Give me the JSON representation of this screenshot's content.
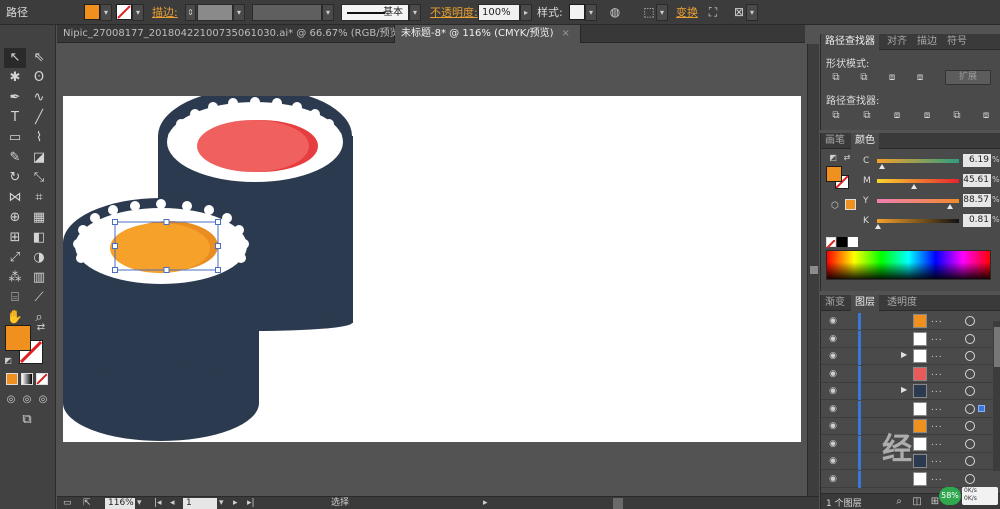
{
  "controlbar": {
    "object_type": "路径",
    "fill_color": "#f0901e",
    "stroke_label": "描边:",
    "stroke_style": "基本",
    "opacity_label": "不透明度:",
    "opacity_value": "100%",
    "style_label": "样式:",
    "transform_label": "变换"
  },
  "tabs": [
    {
      "label": "Nipic_27008177_20180422100735061030.ai* @ 66.67% (RGB/预览)",
      "close": "×"
    },
    {
      "label": "未标题-8* @ 116% (CMYK/预览)",
      "close": "×"
    }
  ],
  "pathfinder_panel": {
    "tabs": [
      "路径查找器",
      "对齐",
      "描边",
      "符号"
    ],
    "shape_modes_label": "形状模式:",
    "expand_label": "扩展",
    "pathfinders_label": "路径查找器:"
  },
  "color_panel": {
    "tabs": [
      "画笔",
      "颜色"
    ],
    "fill_color": "#f0901e",
    "channels": [
      {
        "name": "C",
        "value": "6.19",
        "fraction": 0.0619
      },
      {
        "name": "M",
        "value": "45.61",
        "fraction": 0.4561
      },
      {
        "name": "Y",
        "value": "88.57",
        "fraction": 0.8857
      },
      {
        "name": "K",
        "value": "0.81",
        "fraction": 0.0081
      }
    ],
    "percent_sign": "%"
  },
  "layers_panel": {
    "tabs": [
      "渐变",
      "图层",
      "透明度"
    ],
    "count_label": "1 个图层",
    "rows": [
      {
        "thumb": "#f0901e",
        "expand": false
      },
      {
        "thumb": "#ffffff",
        "expand": false
      },
      {
        "thumb": "#ffffff",
        "expand": true
      },
      {
        "thumb": "#e95a5a",
        "expand": false
      },
      {
        "thumb": "#2c3a4f",
        "expand": true
      },
      {
        "thumb": "#ffffff",
        "expand": false
      },
      {
        "thumb": "#f0901e",
        "expand": false
      },
      {
        "thumb": "#ffffff",
        "expand": false
      },
      {
        "thumb": "#2c3a4f",
        "expand": false
      },
      {
        "thumb": "#ffffff",
        "expand": false
      }
    ]
  },
  "statusbar": {
    "zoom": "116%",
    "page": "1",
    "tool": "选择"
  },
  "watermark": {
    "text": "经"
  },
  "tray": {
    "cpu": "58%",
    "up": "0K/s",
    "down": "0K/s"
  },
  "colors": {
    "seaweed": "#2c3a4f",
    "rice": "#ffffff",
    "tuna": "#f0605e",
    "tuna_shade": "#e63e40",
    "salmon": "#f5a12a",
    "salmon_shade": "#e98c22",
    "selection": "#4a6fc0"
  }
}
